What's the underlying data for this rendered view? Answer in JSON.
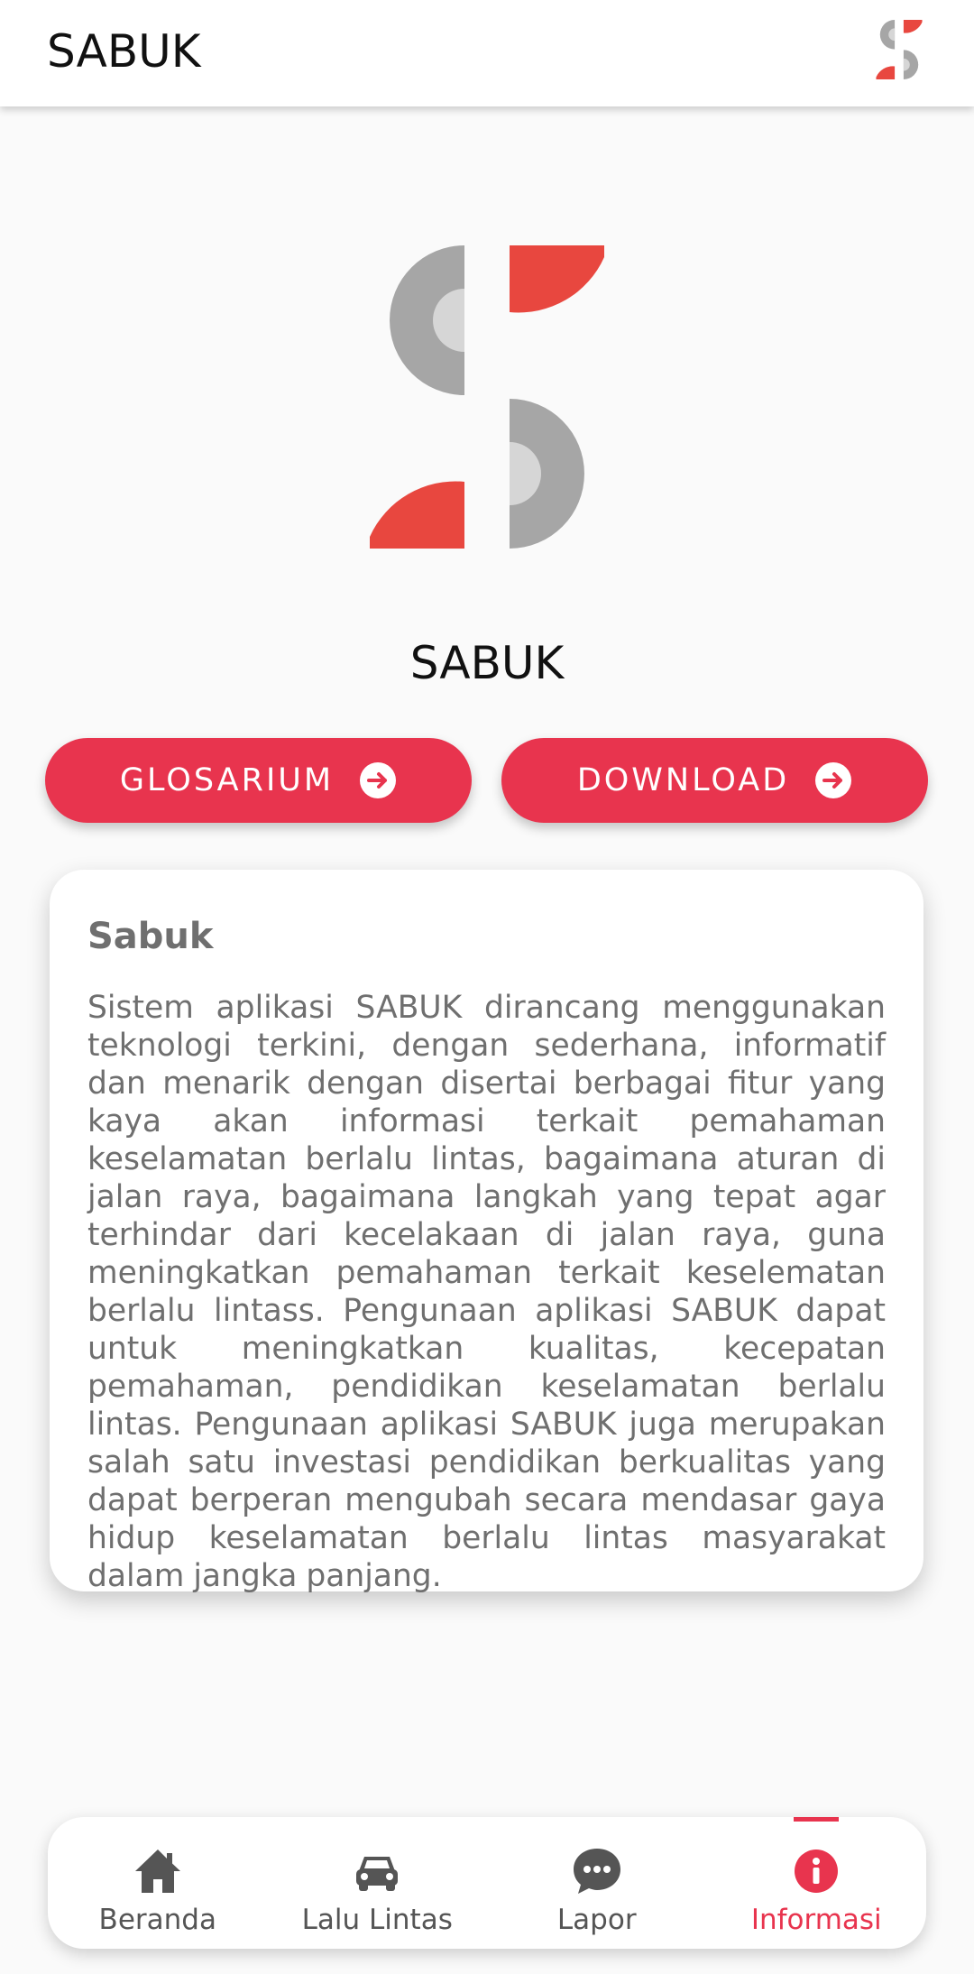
{
  "appbar": {
    "title": "SABUK",
    "logo_icon": "sabuk-logo-icon"
  },
  "hero": {
    "logo_icon": "sabuk-logo-icon",
    "brand_name": "SABUK"
  },
  "buttons": {
    "glosarium": {
      "label": "GLOSARIUM",
      "icon": "arrow-circle-right-icon"
    },
    "download": {
      "label": "DOWNLOAD",
      "icon": "arrow-circle-right-icon"
    }
  },
  "card": {
    "title": "Sabuk",
    "body": "Sistem aplikasi SABUK dirancang menggunakan teknologi terkini, dengan sederhana, informatif dan menarik dengan disertai berbagai fitur yang kaya akan informasi terkait pemahaman keselamatan berlalu lintas, bagaimana aturan di jalan raya, bagaimana langkah yang tepat agar terhindar dari kecelakaan di jalan raya, guna meningkatkan pemahaman terkait keselematan berlalu lintass. Pengunaan aplikasi SABUK dapat untuk meningkatkan kualitas, kecepatan pemahaman, pendidikan keselamatan berlalu lintas. Pengunaan aplikasi SABUK juga merupakan salah satu investasi pendidikan berkualitas yang dapat berperan mengubah secara mendasar gaya hidup keselamatan berlalu lintas masyarakat dalam jangka panjang."
  },
  "bottom_nav": {
    "items": [
      {
        "label": "Beranda",
        "icon": "home-icon",
        "active": false
      },
      {
        "label": "Lalu Lintas",
        "icon": "car-icon",
        "active": false
      },
      {
        "label": "Lapor",
        "icon": "chat-bubble-icon",
        "active": false
      },
      {
        "label": "Informasi",
        "icon": "info-icon",
        "active": true
      }
    ]
  },
  "colors": {
    "accent": "#e8344e",
    "logo_red": "#e8473f",
    "logo_gray_dark": "#a6a6a6",
    "logo_gray_light": "#d6d6d6",
    "text_gray": "#6f6f6f"
  }
}
